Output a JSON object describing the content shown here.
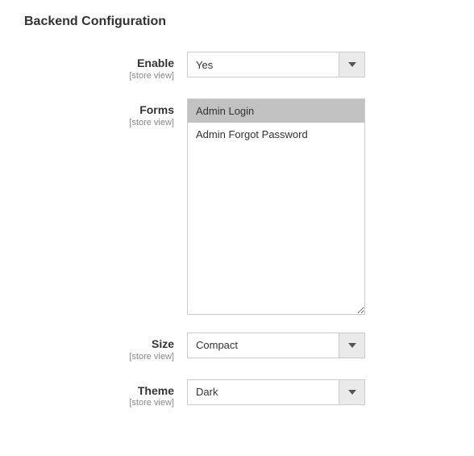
{
  "section": {
    "title": "Backend Configuration"
  },
  "scopeLabel": "[store view]",
  "fields": {
    "enable": {
      "label": "Enable",
      "value": "Yes"
    },
    "forms": {
      "label": "Forms",
      "options": [
        {
          "label": "Admin Login",
          "selected": true
        },
        {
          "label": "Admin Forgot Password",
          "selected": false
        }
      ]
    },
    "size": {
      "label": "Size",
      "value": "Compact"
    },
    "theme": {
      "label": "Theme",
      "value": "Dark"
    }
  }
}
